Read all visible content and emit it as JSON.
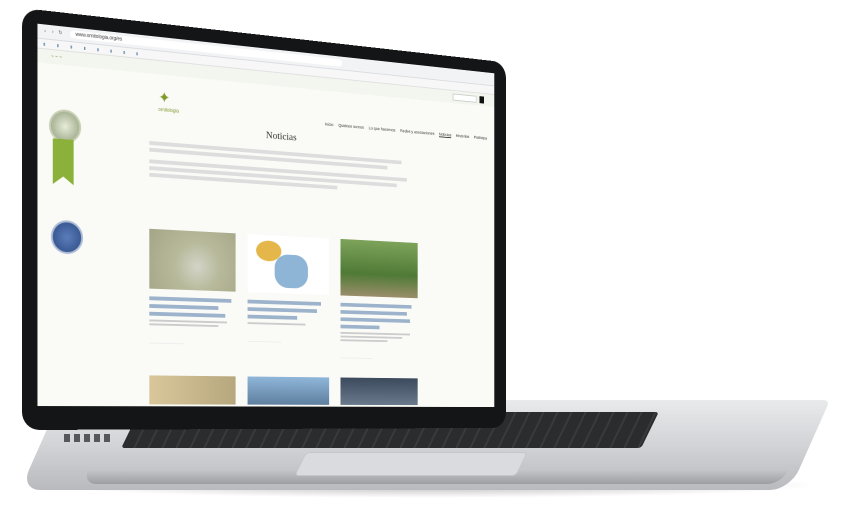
{
  "browser": {
    "url": "www.ornitologia.org/es",
    "bookmarks": [
      "",
      "",
      "",
      "",
      "",
      "",
      "",
      "",
      "",
      "",
      "",
      ""
    ]
  },
  "site": {
    "logo_text": "ornitologia",
    "menu": [
      "Inicio",
      "Quiénes somos",
      "Lo que hacemos",
      "Redes y asociaciones",
      "Noticias",
      "Historias",
      "Participa"
    ],
    "active_menu": "Noticias",
    "page_title": "Noticias"
  },
  "colors": {
    "accent": "#7f9a2d",
    "link": "#2f5f90",
    "ribbon": "#8bb13a"
  }
}
